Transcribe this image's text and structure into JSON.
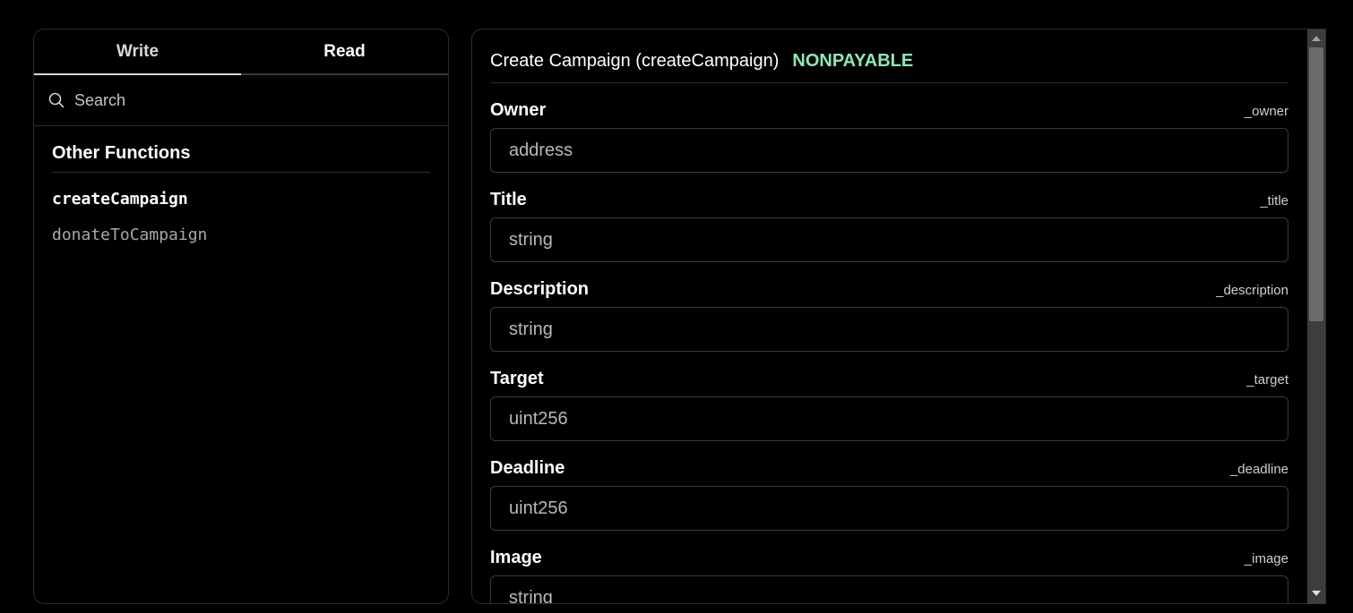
{
  "tabs": {
    "write": "Write",
    "read": "Read"
  },
  "search": {
    "placeholder": "Search"
  },
  "sidebar": {
    "group_title": "Other Functions",
    "functions": [
      "createCampaign",
      "donateToCampaign"
    ]
  },
  "function": {
    "title": "Create Campaign (createCampaign)",
    "mutability": "NONPAYABLE",
    "params": [
      {
        "label": "Owner",
        "name": "_owner",
        "type": "address"
      },
      {
        "label": "Title",
        "name": "_title",
        "type": "string"
      },
      {
        "label": "Description",
        "name": "_description",
        "type": "string"
      },
      {
        "label": "Target",
        "name": "_target",
        "type": "uint256"
      },
      {
        "label": "Deadline",
        "name": "_deadline",
        "type": "uint256"
      },
      {
        "label": "Image",
        "name": "_image",
        "type": "string"
      }
    ]
  },
  "colors": {
    "background": "#000000",
    "badge": "#8ee6b5",
    "border": "#2c2c2c"
  },
  "icons": {
    "search": "search-icon",
    "scroll_up": "arrow-up-icon",
    "scroll_down": "arrow-down-icon"
  }
}
